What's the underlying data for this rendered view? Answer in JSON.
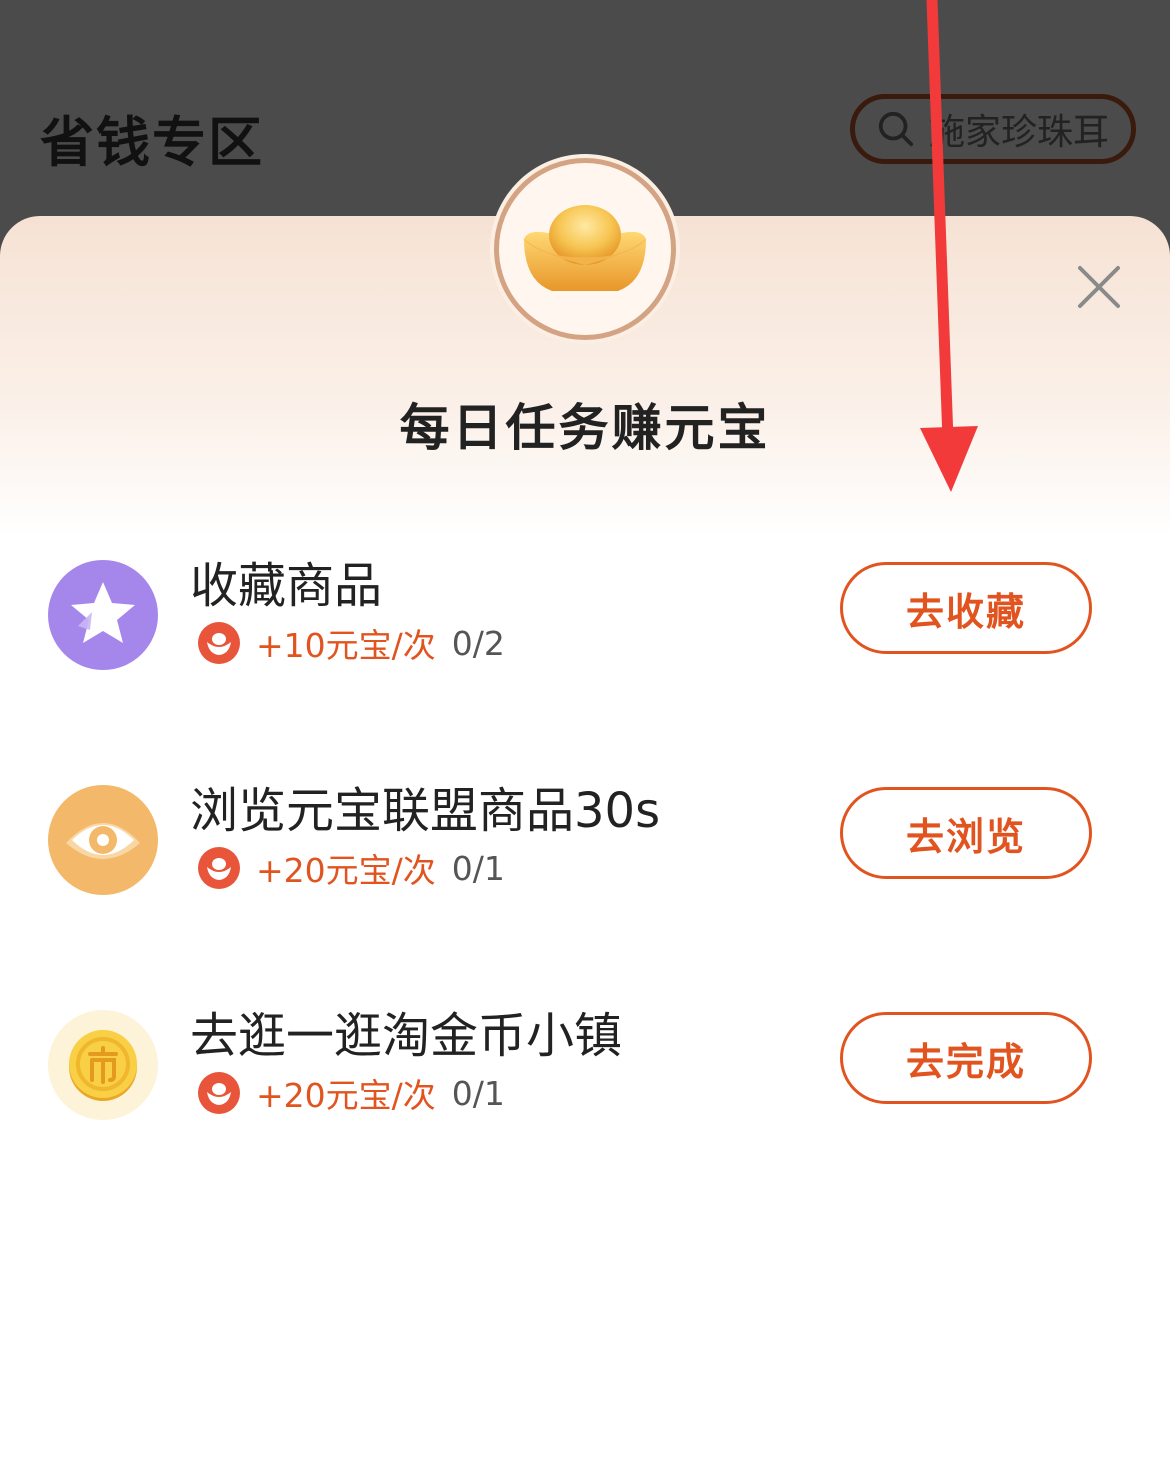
{
  "background": {
    "title": "省钱专区",
    "search_placeholder": "施家珍珠耳",
    "search_icon": "search-icon"
  },
  "modal": {
    "title": "每日任务赚元宝",
    "badge_icon": "gold-ingot-icon",
    "close_icon": "close-icon",
    "tasks": [
      {
        "icon": "star-icon",
        "icon_color": "#a587ec",
        "title": "收藏商品",
        "reward": "+10元宝/次",
        "progress": "0/2",
        "button": "去收藏"
      },
      {
        "icon": "eye-icon",
        "icon_color": "#f3b86a",
        "title": "浏览元宝联盟商品30s",
        "reward": "+20元宝/次",
        "progress": "0/1",
        "button": "去浏览"
      },
      {
        "icon": "coin-icon",
        "icon_color": "#f6c53a",
        "title": "去逛一逛淘金币小镇",
        "reward": "+20元宝/次",
        "progress": "0/1",
        "button": "去完成"
      }
    ]
  },
  "colors": {
    "accent": "#e1541f",
    "annotation_arrow": "#f23a3a"
  }
}
